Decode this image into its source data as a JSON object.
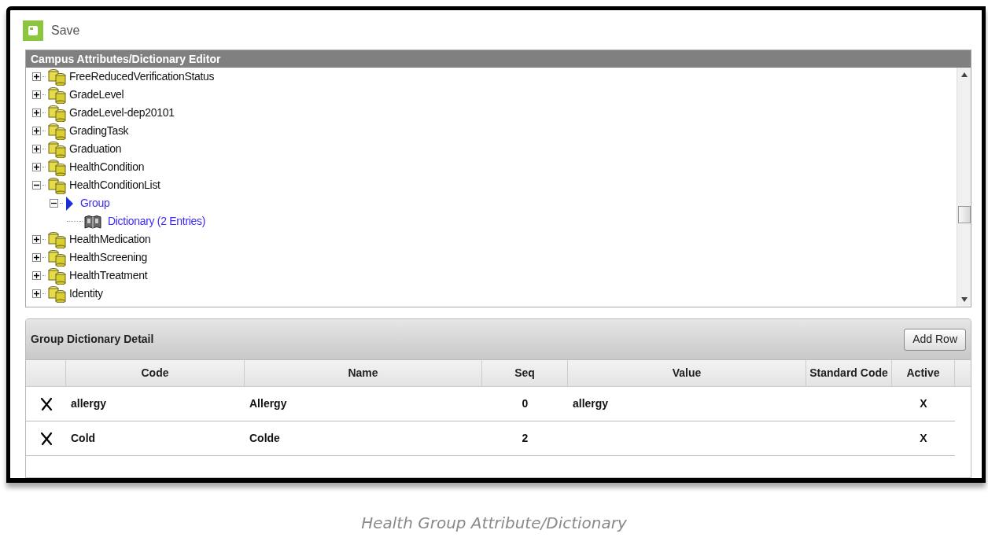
{
  "toolbar": {
    "save_label": "Save"
  },
  "editor": {
    "title": "Campus Attributes/Dictionary Editor",
    "tree": [
      {
        "label": "FreeReducedVerificationStatus",
        "kind": "folder",
        "expanded": false
      },
      {
        "label": "GradeLevel",
        "kind": "folder",
        "expanded": false
      },
      {
        "label": "GradeLevel-dep20101",
        "kind": "folder",
        "expanded": false
      },
      {
        "label": "GradingTask",
        "kind": "folder",
        "expanded": false
      },
      {
        "label": "Graduation",
        "kind": "folder",
        "expanded": false
      },
      {
        "label": "HealthCondition",
        "kind": "folder",
        "expanded": false
      },
      {
        "label": "HealthConditionList",
        "kind": "folder",
        "expanded": true,
        "children": [
          {
            "label": "Group",
            "kind": "group",
            "expanded": true,
            "children": [
              {
                "label": "Dictionary (2 Entries)",
                "kind": "dictionary"
              }
            ]
          }
        ]
      },
      {
        "label": "HealthMedication",
        "kind": "folder",
        "expanded": false
      },
      {
        "label": "HealthScreening",
        "kind": "folder",
        "expanded": false
      },
      {
        "label": "HealthTreatment",
        "kind": "folder",
        "expanded": false
      },
      {
        "label": "Identity",
        "kind": "folder",
        "expanded": false
      }
    ]
  },
  "detail": {
    "title": "Group Dictionary Detail",
    "add_button": "Add Row",
    "columns": [
      "Code",
      "Name",
      "Seq",
      "Value",
      "Standard Code",
      "Active"
    ],
    "rows": [
      {
        "code": "allergy",
        "name": "Allergy",
        "seq": "0",
        "value": "allergy",
        "active": "X"
      },
      {
        "code": "Cold",
        "name": "Colde",
        "seq": "2",
        "active": "X"
      }
    ]
  },
  "caption": "Health Group Attribute/Dictionary"
}
